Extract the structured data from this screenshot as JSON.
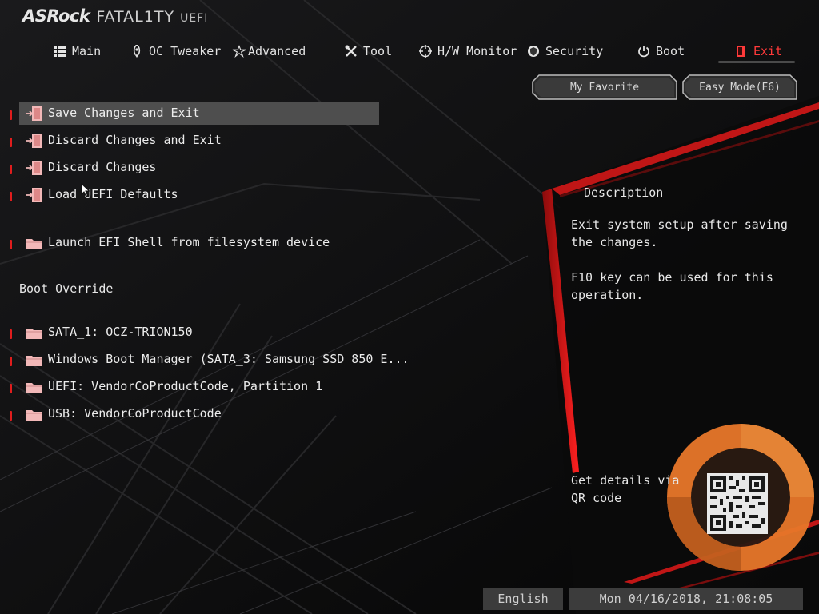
{
  "header": {
    "brand": "ASRock",
    "series": "FATAL1TY",
    "uefi": "UEFI"
  },
  "tabs": [
    {
      "label": "Main",
      "icon": "list-icon"
    },
    {
      "label": "OC Tweaker",
      "icon": "rocket-icon"
    },
    {
      "label": "Advanced",
      "icon": "star-icon"
    },
    {
      "label": "Tool",
      "icon": "tools-icon"
    },
    {
      "label": "H/W Monitor",
      "icon": "crosshair-icon"
    },
    {
      "label": "Security",
      "icon": "shield-icon"
    },
    {
      "label": "Boot",
      "icon": "power-icon"
    },
    {
      "label": "Exit",
      "icon": "exit-icon"
    }
  ],
  "active_tab": "Exit",
  "top_buttons": {
    "favorite": "My Favorite",
    "easy_mode": "Easy Mode(F6)"
  },
  "menu": {
    "items": [
      {
        "label": "Save Changes and Exit"
      },
      {
        "label": "Discard Changes and Exit"
      },
      {
        "label": "Discard Changes"
      },
      {
        "label": "Load UEFI Defaults"
      },
      {
        "label": "Launch EFI Shell from filesystem device"
      }
    ],
    "selected_index": 0
  },
  "boot_override": {
    "title": "Boot Override",
    "items": [
      {
        "label": "SATA_1: OCZ-TRION150"
      },
      {
        "label": "Windows Boot Manager (SATA_3: Samsung SSD 850 E..."
      },
      {
        "label": "UEFI: VendorCoProductCode, Partition 1"
      },
      {
        "label": "USB: VendorCoProductCode"
      }
    ]
  },
  "description": {
    "title": "Description",
    "line1": "Exit system setup after saving the changes.",
    "line2": "F10 key can be used for this operation."
  },
  "qr": {
    "label": "Get details via QR code"
  },
  "footer": {
    "language": "English",
    "datetime": "Mon 04/16/2018, 21:08:05"
  },
  "colors": {
    "accent": "#e01d1d",
    "active_tab": "#ff3a3a",
    "highlight": "#4e4e4e",
    "background": "#0b0b0c"
  }
}
